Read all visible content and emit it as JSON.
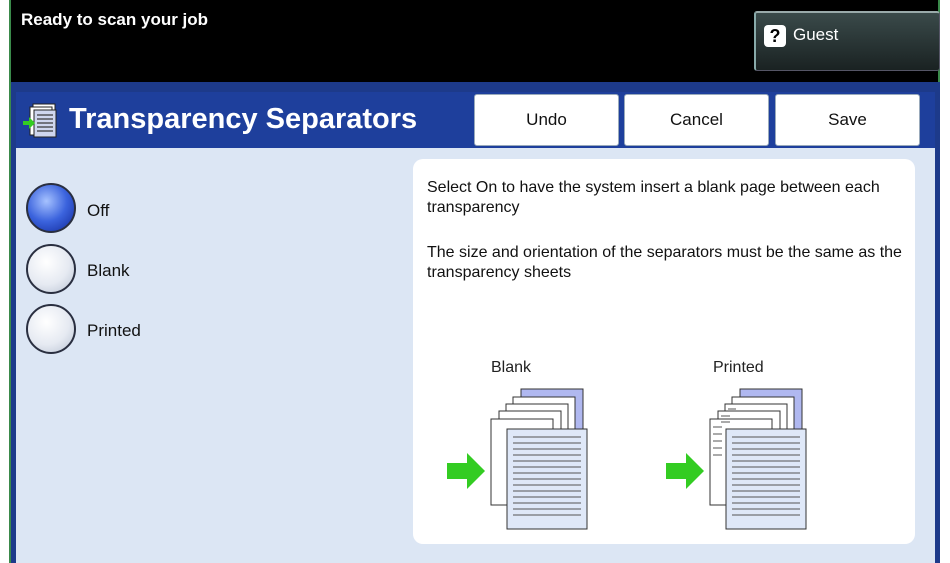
{
  "status": {
    "text": "Ready to scan your job"
  },
  "guest": {
    "label": "Guest",
    "icon": "help-question-icon"
  },
  "title_bar": {
    "title": "Transparency Separators",
    "icon": "transparency-document-icon"
  },
  "toolbar": {
    "undo_label": "Undo",
    "cancel_label": "Cancel",
    "save_label": "Save"
  },
  "options": [
    {
      "label": "Off",
      "selected": true
    },
    {
      "label": "Blank",
      "selected": false
    },
    {
      "label": "Printed",
      "selected": false
    }
  ],
  "info": {
    "line1": "Select On to have the system insert a blank page between each transparency",
    "line2": "The size and orientation of the separators must be the same as the transparency sheets"
  },
  "illustrations": {
    "blank_label": "Blank",
    "printed_label": "Printed"
  },
  "colors": {
    "panel_blue": "#1d3a8a",
    "content_bg": "#dce6f4",
    "arrow_green": "#33cc22",
    "back_sheet": "#b0b8f0"
  }
}
